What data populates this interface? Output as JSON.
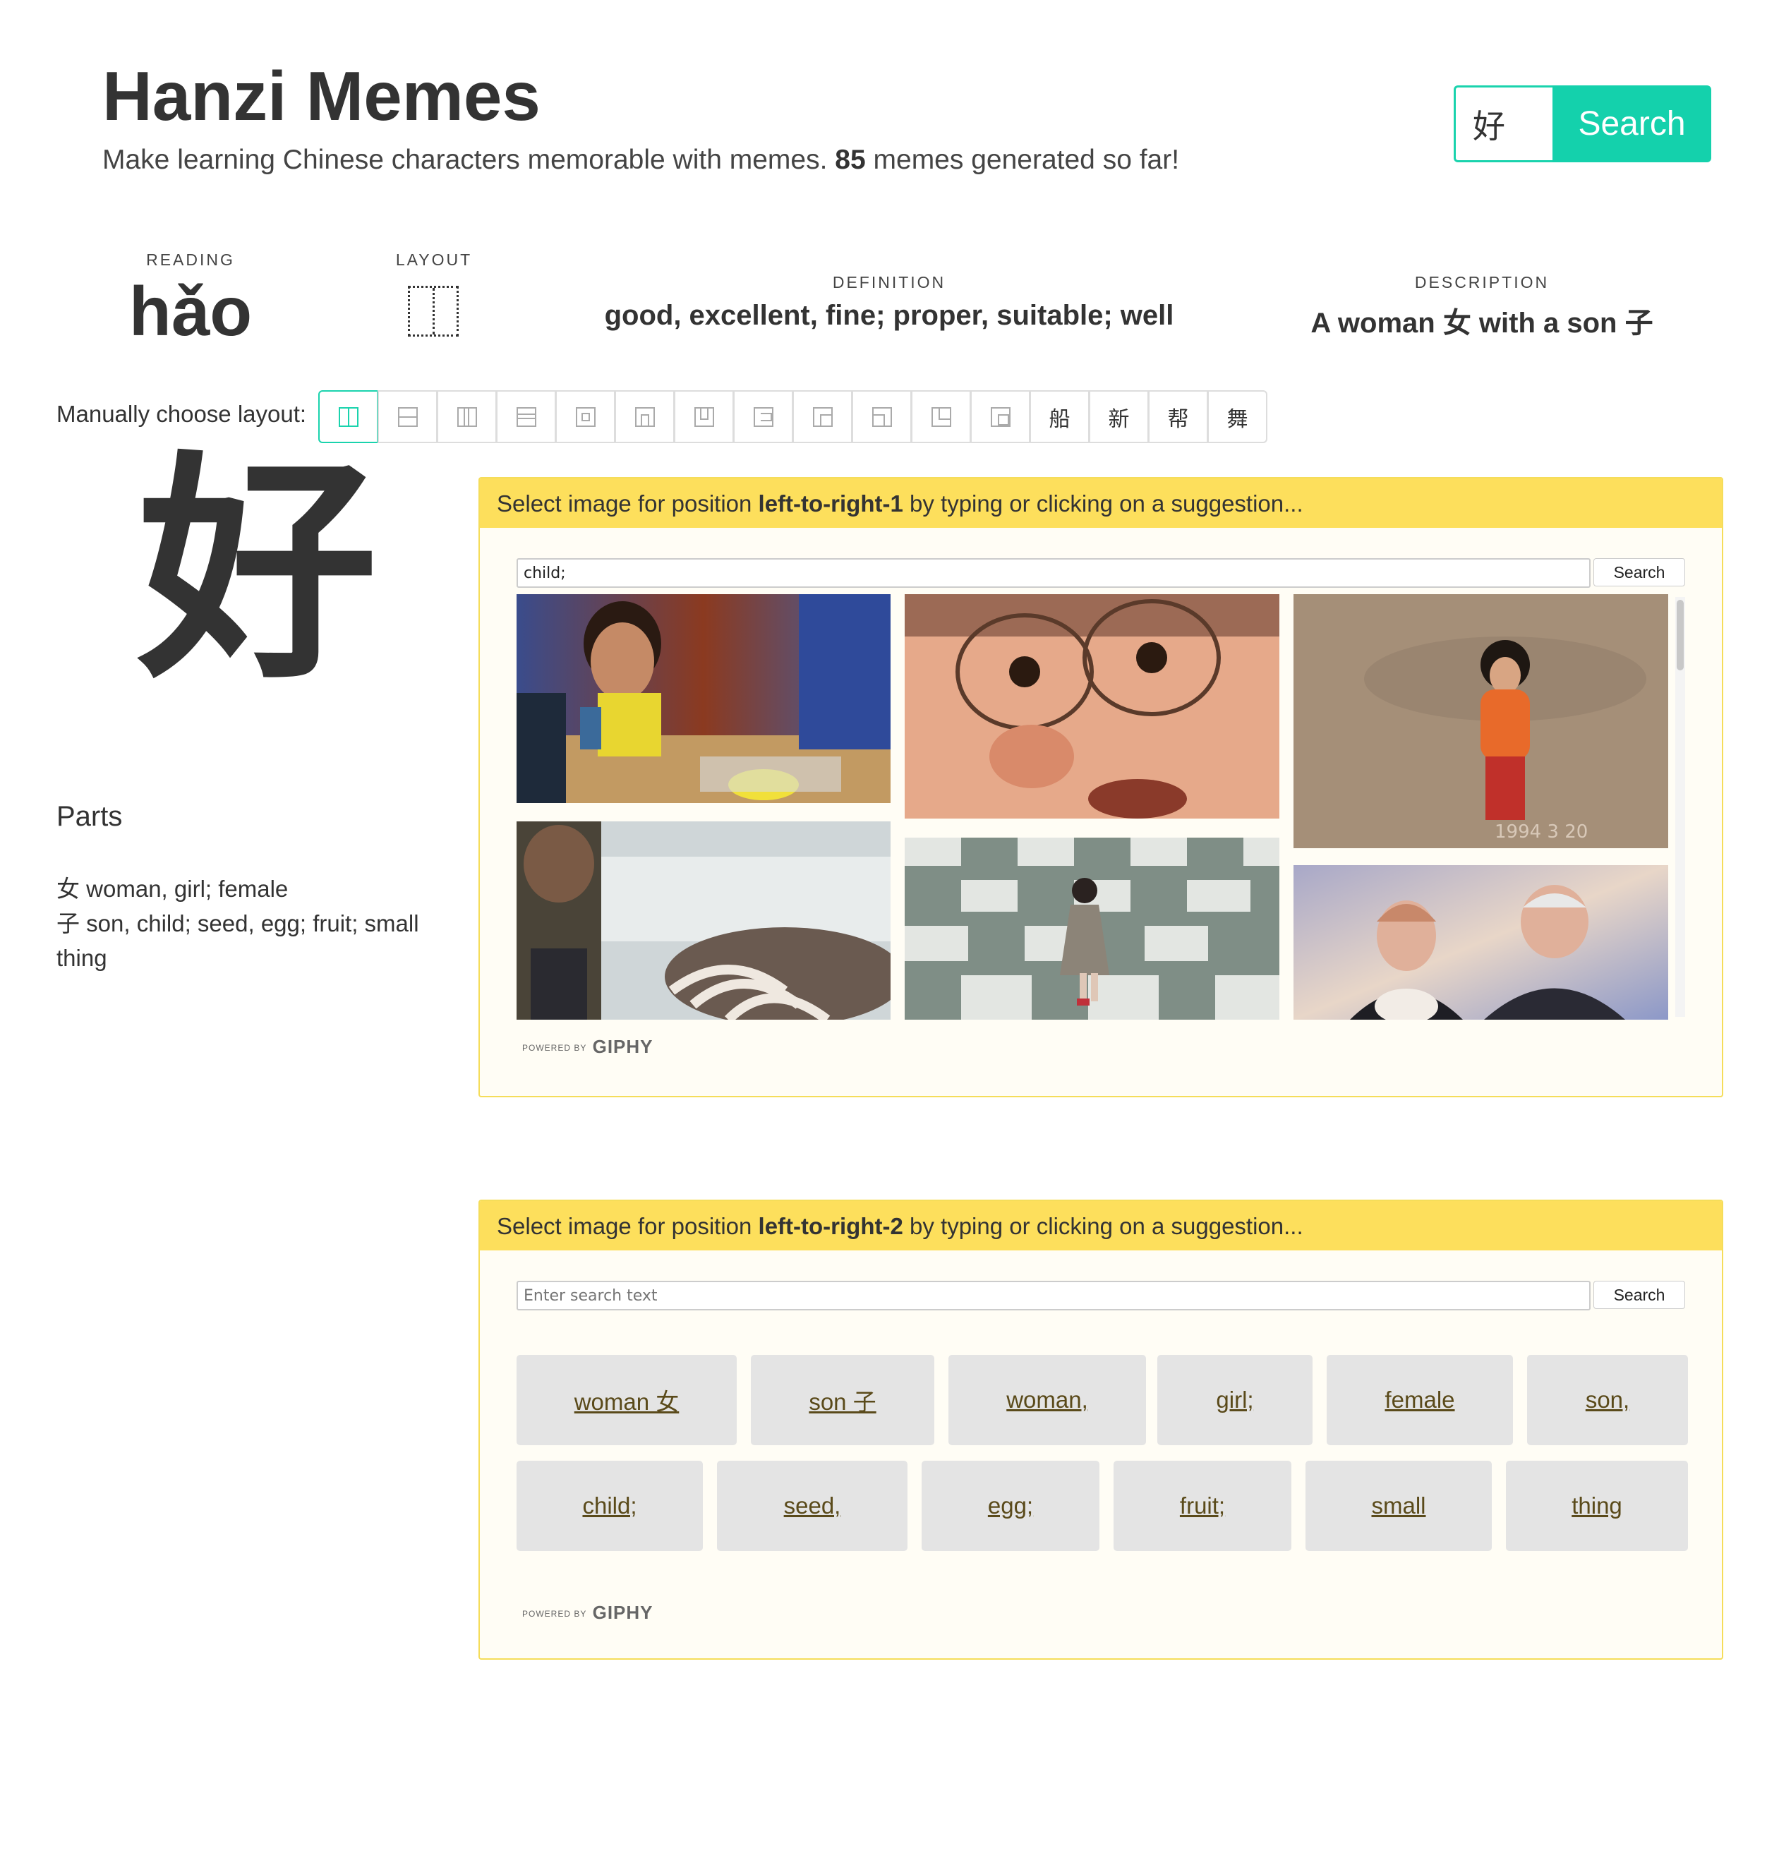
{
  "header": {
    "title": "Hanzi Memes",
    "tagline_pre": "Make learning Chinese characters memorable with memes.",
    "meme_count": "85",
    "tagline_post": "memes generated so far!",
    "search_value": "好",
    "search_button": "Search",
    "accent_color": "#14d1ac"
  },
  "info": {
    "reading_label": "READING",
    "reading": "hǎo",
    "layout_label": "LAYOUT",
    "layout_icon": "left-right-layout-icon",
    "definition_label": "DEFINITION",
    "definition": "good, excellent, fine; proper, suitable; well",
    "description_label": "DESCRIPTION",
    "description": "A woman 女 with a son 子"
  },
  "layout_chooser": {
    "label": "Manually choose layout:",
    "buttons": [
      {
        "name": "left-right-icon"
      },
      {
        "name": "top-bottom-icon"
      },
      {
        "name": "left-middle-right-icon"
      },
      {
        "name": "top-middle-bottom-icon"
      },
      {
        "name": "full-surround-icon"
      },
      {
        "name": "surround-from-above-icon"
      },
      {
        "name": "surround-from-below-icon"
      },
      {
        "name": "surround-from-left-icon"
      },
      {
        "name": "surround-from-upper-left-icon"
      },
      {
        "name": "surround-from-upper-right-icon"
      },
      {
        "name": "surround-from-lower-left-icon"
      },
      {
        "name": "overlaid-icon"
      },
      {
        "char": "船"
      },
      {
        "char": "新"
      },
      {
        "char": "帮"
      },
      {
        "char": "舞"
      }
    ]
  },
  "character": "好",
  "parts": {
    "title": "Parts",
    "items": [
      {
        "char": "女",
        "meaning": "woman, girl; female"
      },
      {
        "char": "子",
        "meaning": "son, child; seed, egg; fruit; small thing"
      }
    ]
  },
  "panel1": {
    "prefix": "Select image for position",
    "position": "left-to-right-1",
    "suffix": "by typing or clicking on a suggestion...",
    "search_value": "child;",
    "search_button": "Search",
    "powered_by": "POWERED BY",
    "giphy": "GIPHY"
  },
  "panel2": {
    "prefix": "Select image for position",
    "position": "left-to-right-2",
    "suffix": "by typing or clicking on a suggestion...",
    "search_placeholder": "Enter search text",
    "search_button": "Search",
    "suggestions_row1": [
      "woman 女",
      "son 子",
      "woman,",
      "girl;",
      "female",
      "son,"
    ],
    "suggestions_row2": [
      "child;",
      "seed,",
      "egg;",
      "fruit;",
      "small",
      "thing"
    ],
    "powered_by": "POWERED BY",
    "giphy": "GIPHY"
  }
}
